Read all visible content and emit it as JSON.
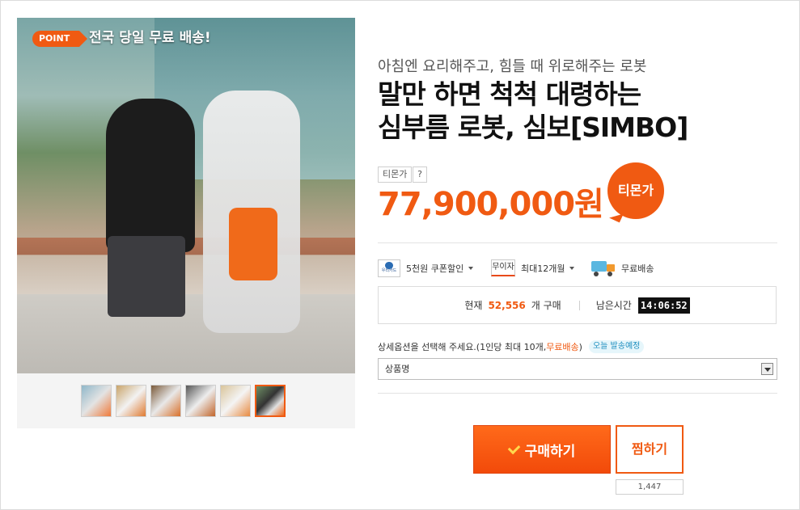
{
  "gallery": {
    "point_badge": "POINT",
    "point_text": "전국 당일 무료 배송!",
    "thumbnail_count": 6
  },
  "product": {
    "subtitle": "아침엔 요리해주고, 힘들 때 위로해주는 로봇",
    "title_line1": "말만 하면 척척 대령하는",
    "title_line2": "심부름 로봇, 심보[SIMBO]"
  },
  "price": {
    "label": "티몬가",
    "help": "?",
    "value": "77,900,000원",
    "bubble": "티몬가"
  },
  "benefits": {
    "coupon_icon_text": "우리카드",
    "coupon_label": "5천원 쿠폰할인",
    "installment_icon_text": "무이자",
    "installment_label": "최대12개월",
    "shipping_label": "무료배송"
  },
  "status": {
    "current_label": "현재",
    "count": "52,556",
    "count_suffix": "개 구매",
    "remaining_label": "남은시간",
    "timer": "14:06:52"
  },
  "options": {
    "instruction": "상세옵션을 선택해 주세요.(1인당 최대 10개, ",
    "free_shipping": "무료배송",
    "instruction_end": ")",
    "ship_badge": "오늘 발송예정",
    "select_value": "상품명"
  },
  "actions": {
    "buy_label": "구매하기",
    "wish_label": "찜하기",
    "wish_count": "1,447"
  },
  "colors": {
    "accent": "#f05a12",
    "timer_bg": "#111111",
    "ship_badge": "#1f8fbf"
  }
}
